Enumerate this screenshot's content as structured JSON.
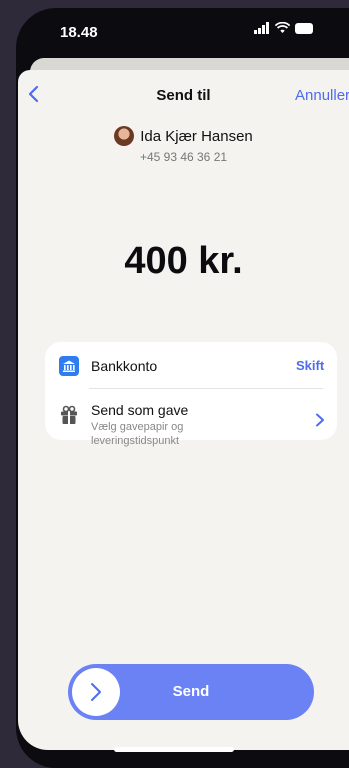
{
  "status": {
    "time": "18.48"
  },
  "nav": {
    "title": "Send til",
    "cancel": "Annuller"
  },
  "recipient": {
    "name": "Ida Kjær Hansen",
    "phone": "+45 93 46 36 21"
  },
  "amount": "400 kr.",
  "payment": {
    "bank_label": "Bankkonto",
    "change_label": "Skift",
    "gift_title": "Send som gave",
    "gift_subtitle": "Vælg gavepapir og leveringstidspunkt"
  },
  "send": {
    "label": "Send"
  },
  "colors": {
    "accent": "#4d6cf0",
    "send_button": "#6a82f4",
    "bank_icon": "#2f7bf0"
  }
}
